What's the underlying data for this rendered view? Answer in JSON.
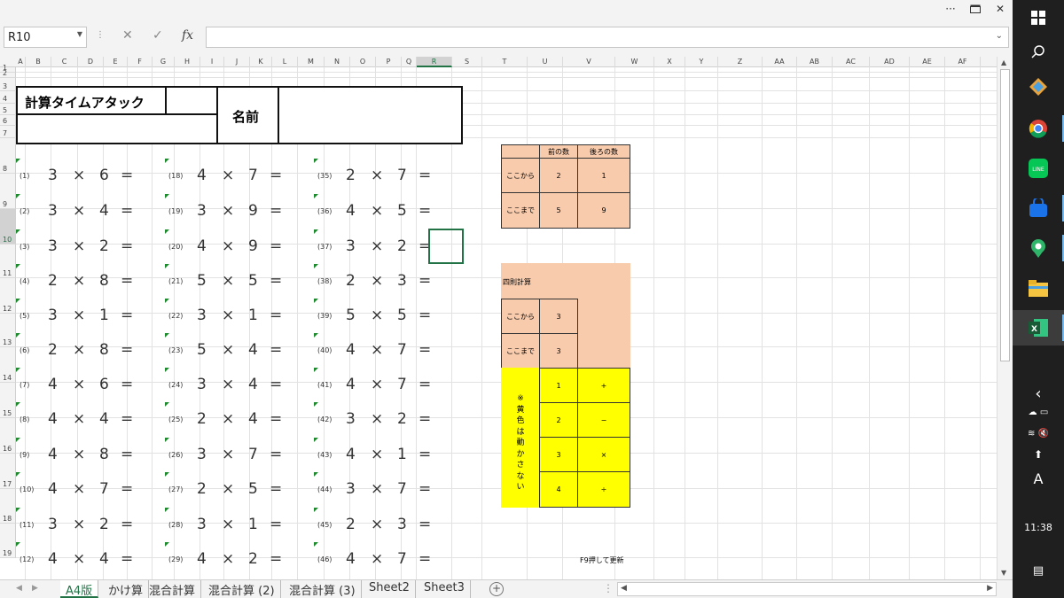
{
  "titlebar": {
    "more": "···"
  },
  "formula_bar": {
    "cell_ref": "R10",
    "cancel_icon": "✕",
    "enter_icon": "✓",
    "fx_label": "fx",
    "formula": ""
  },
  "columns": [
    "A",
    "B",
    "C",
    "D",
    "E",
    "F",
    "G",
    "H",
    "I",
    "J",
    "K",
    "L",
    "M",
    "N",
    "O",
    "P",
    "Q",
    "R",
    "S",
    "T",
    "U",
    "V",
    "W",
    "X",
    "Y",
    "Z",
    "AA",
    "AB",
    "AC",
    "AD",
    "AE",
    "AF"
  ],
  "selected_column": "R",
  "rows": [
    "1",
    "2",
    "3",
    "4",
    "5",
    "6",
    "7",
    "8",
    "9",
    "10",
    "11",
    "12",
    "13",
    "14",
    "15",
    "16",
    "17",
    "18",
    "19"
  ],
  "selected_row": "10",
  "sheet": {
    "title": "計算タイムアタック",
    "name_label": "名前",
    "op_symbol": "×",
    "eq_symbol": "=",
    "problems": [
      [
        {
          "n": "(1)",
          "a": "3",
          "b": "6"
        },
        {
          "n": "(2)",
          "a": "3",
          "b": "4"
        },
        {
          "n": "(3)",
          "a": "3",
          "b": "2"
        },
        {
          "n": "(4)",
          "a": "2",
          "b": "8"
        },
        {
          "n": "(5)",
          "a": "3",
          "b": "1"
        },
        {
          "n": "(6)",
          "a": "2",
          "b": "8"
        },
        {
          "n": "(7)",
          "a": "4",
          "b": "6"
        },
        {
          "n": "(8)",
          "a": "4",
          "b": "4"
        },
        {
          "n": "(9)",
          "a": "4",
          "b": "8"
        },
        {
          "n": "(10)",
          "a": "4",
          "b": "7"
        },
        {
          "n": "(11)",
          "a": "3",
          "b": "2"
        },
        {
          "n": "(12)",
          "a": "4",
          "b": "4"
        }
      ],
      [
        {
          "n": "(18)",
          "a": "4",
          "b": "7"
        },
        {
          "n": "(19)",
          "a": "3",
          "b": "9"
        },
        {
          "n": "(20)",
          "a": "4",
          "b": "9"
        },
        {
          "n": "(21)",
          "a": "5",
          "b": "5"
        },
        {
          "n": "(22)",
          "a": "3",
          "b": "1"
        },
        {
          "n": "(23)",
          "a": "5",
          "b": "4"
        },
        {
          "n": "(24)",
          "a": "3",
          "b": "4"
        },
        {
          "n": "(25)",
          "a": "2",
          "b": "4"
        },
        {
          "n": "(26)",
          "a": "3",
          "b": "7"
        },
        {
          "n": "(27)",
          "a": "2",
          "b": "5"
        },
        {
          "n": "(28)",
          "a": "3",
          "b": "1"
        },
        {
          "n": "(29)",
          "a": "4",
          "b": "2"
        }
      ],
      [
        {
          "n": "(35)",
          "a": "2",
          "b": "7"
        },
        {
          "n": "(36)",
          "a": "4",
          "b": "5"
        },
        {
          "n": "(37)",
          "a": "3",
          "b": "2"
        },
        {
          "n": "(38)",
          "a": "2",
          "b": "3"
        },
        {
          "n": "(39)",
          "a": "5",
          "b": "5"
        },
        {
          "n": "(40)",
          "a": "4",
          "b": "7"
        },
        {
          "n": "(41)",
          "a": "4",
          "b": "7"
        },
        {
          "n": "(42)",
          "a": "3",
          "b": "2"
        },
        {
          "n": "(43)",
          "a": "4",
          "b": "1"
        },
        {
          "n": "(44)",
          "a": "3",
          "b": "7"
        },
        {
          "n": "(45)",
          "a": "2",
          "b": "3"
        },
        {
          "n": "(46)",
          "a": "4",
          "b": "7"
        }
      ]
    ]
  },
  "settings": {
    "range_header": [
      "前の数",
      "後ろの数"
    ],
    "range_rows": [
      {
        "label": "ここから",
        "front": "2",
        "back": "1"
      },
      {
        "label": "ここまで",
        "front": "5",
        "back": "9"
      }
    ],
    "four_ops_title": "四則計算",
    "ops_rows": [
      {
        "label": "ここから",
        "value": "3"
      },
      {
        "label": "ここまで",
        "value": "3"
      }
    ],
    "note": "※黄色は動かさない",
    "ops_table": [
      {
        "num": "1",
        "sym": "+"
      },
      {
        "num": "2",
        "sym": "−"
      },
      {
        "num": "3",
        "sym": "×"
      },
      {
        "num": "4",
        "sym": "÷"
      }
    ],
    "f9_note": "F9押して更新"
  },
  "tabs": [
    "A4版",
    "かけ算",
    "混合計算",
    "混合計算 (2)",
    "混合計算 (3)",
    "Sheet2",
    "Sheet3"
  ],
  "active_tab": "A4版",
  "add_sheet": "+",
  "taskbar": {
    "clock": "11:38",
    "ime": "A"
  },
  "colors": {
    "excel_green": "#217346",
    "orange": "#f8cbad",
    "yellow": "#ffff00"
  }
}
